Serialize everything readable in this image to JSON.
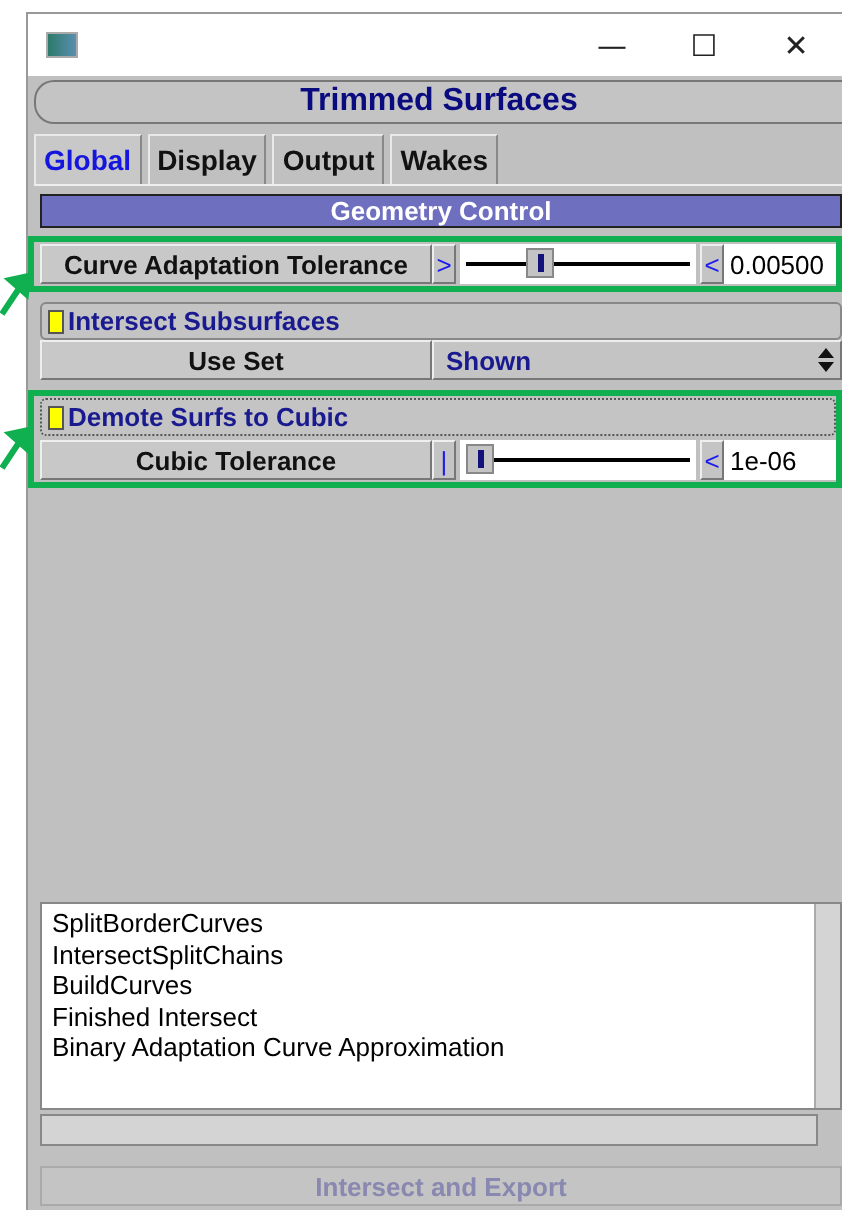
{
  "window": {
    "title_bar_buttons": [
      "—",
      "☐",
      "✕"
    ]
  },
  "header": {
    "title": "Trimmed Surfaces"
  },
  "tabs": [
    {
      "label": "Global",
      "selected": true
    },
    {
      "label": "Display",
      "selected": false
    },
    {
      "label": "Output",
      "selected": false
    },
    {
      "label": "Wakes",
      "selected": false
    }
  ],
  "section": {
    "title": "Geometry Control"
  },
  "rows": [
    {
      "kind": "slider",
      "highlighted": true,
      "label": "Curve Adaptation Tolerance",
      "left_button": ">",
      "right_button": "<",
      "level": 0.32,
      "value": "0.00500"
    },
    {
      "kind": "toggle",
      "highlighted": false,
      "label": "Intersect Subsurfaces",
      "checked": true
    },
    {
      "kind": "choice",
      "highlighted": false,
      "label": "Use Set",
      "value": "Shown"
    },
    {
      "kind": "toggle",
      "highlighted": true,
      "label": "Demote Surfs to Cubic",
      "checked": true
    },
    {
      "kind": "slider",
      "highlighted": true,
      "label": "Cubic Tolerance",
      "left_button": "|",
      "right_button": "<",
      "level": 0.03,
      "value": "1e-06"
    }
  ],
  "log": {
    "lines": [
      "SplitBorderCurves",
      "IntersectSplitChains",
      "BuildCurves",
      "Finished Intersect",
      "Binary Adaptation Curve Approximation"
    ]
  },
  "action_button": {
    "label": "Intersect and Export",
    "disabled": true
  }
}
